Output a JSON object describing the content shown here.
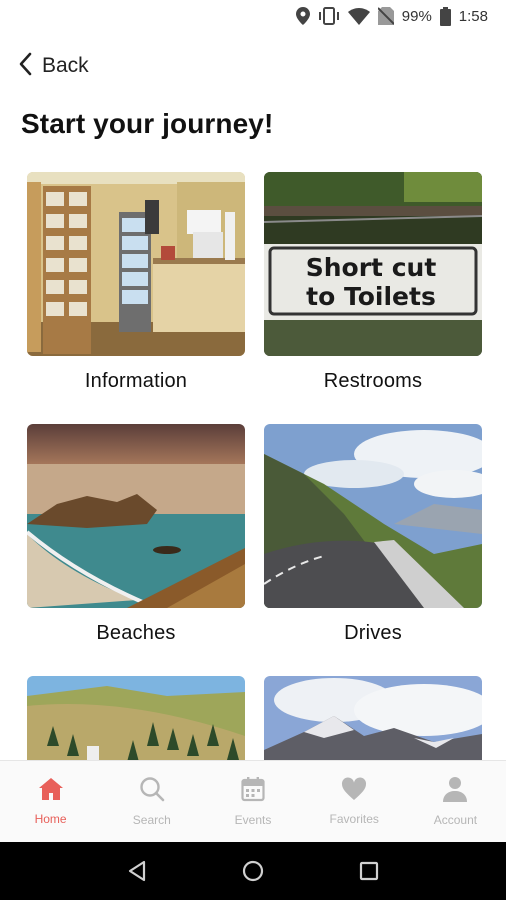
{
  "status_bar": {
    "battery": "99%",
    "time": "1:58"
  },
  "header": {
    "back_label": "Back",
    "title": "Start your journey!"
  },
  "cards": [
    {
      "label": "Information"
    },
    {
      "label": "Restrooms",
      "sign_line1": "Short cut",
      "sign_line2": "to Toilets"
    },
    {
      "label": "Beaches"
    },
    {
      "label": "Drives"
    },
    {
      "label": ""
    },
    {
      "label": ""
    }
  ],
  "bottom_nav": [
    {
      "label": "Home",
      "icon": "home-icon",
      "active": true
    },
    {
      "label": "Search",
      "icon": "search-icon",
      "active": false
    },
    {
      "label": "Events",
      "icon": "calendar-icon",
      "active": false
    },
    {
      "label": "Favorites",
      "icon": "heart-icon",
      "active": false
    },
    {
      "label": "Account",
      "icon": "person-icon",
      "active": false
    }
  ],
  "colors": {
    "accent": "#e8605a",
    "inactive": "#b6b6b6"
  }
}
